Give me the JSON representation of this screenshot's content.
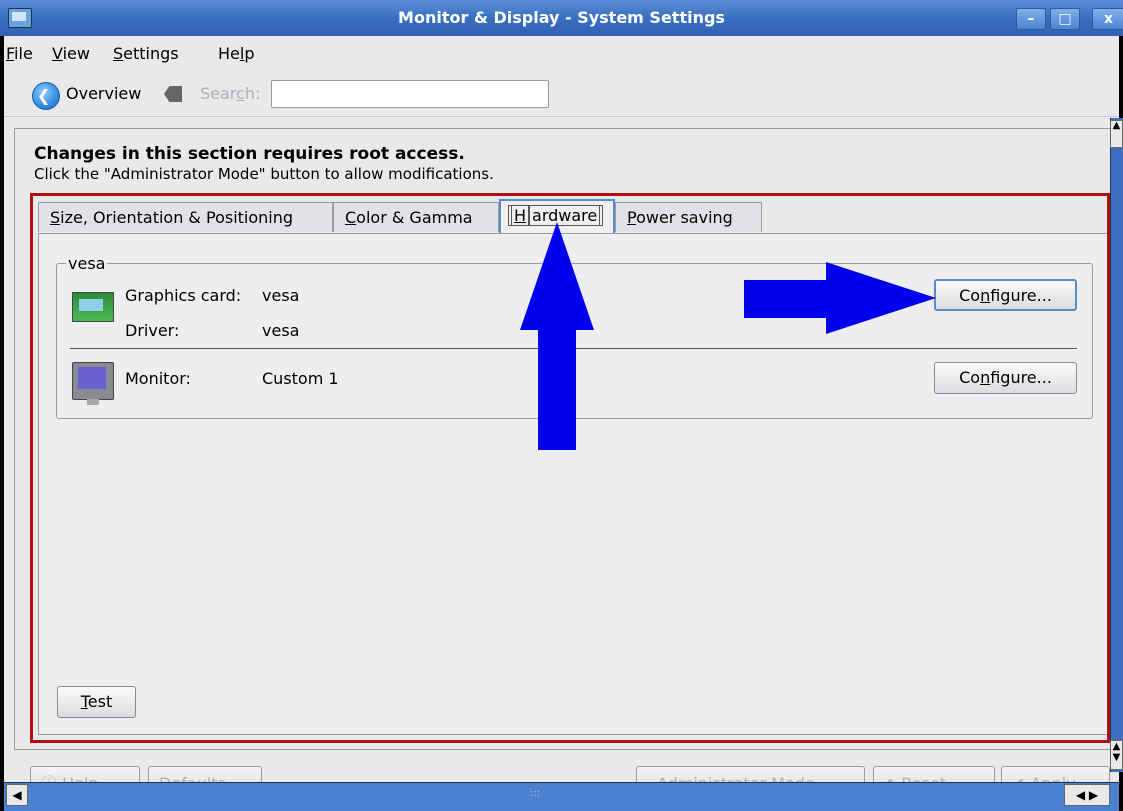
{
  "window": {
    "title": "Monitor & Display - System Settings",
    "controls": {
      "minimize": "–",
      "maximize": "□",
      "close": "x"
    }
  },
  "menubar": [
    {
      "pre": "",
      "key": "F",
      "post": "ile"
    },
    {
      "pre": "",
      "key": "V",
      "post": "iew"
    },
    {
      "pre": "",
      "key": "S",
      "post": "ettings"
    },
    {
      "pre": "He",
      "key": "l",
      "post": "p"
    }
  ],
  "toolbar": {
    "overview_label": "Overview",
    "search_label": {
      "pre": "Sear",
      "key": "c",
      "post": "h:"
    },
    "search_value": ""
  },
  "notice": {
    "title": "Changes in this section requires root access.",
    "subtitle": "Click the \"Administrator Mode\" button to allow modifications."
  },
  "tabs": [
    {
      "pre": "",
      "key": "S",
      "post": "ize, Orientation & Positioning"
    },
    {
      "pre": "",
      "key": "C",
      "post": "olor & Gamma"
    },
    {
      "pre": "",
      "key": "H",
      "post": "ardware"
    },
    {
      "pre": "",
      "key": "P",
      "post": "ower saving"
    }
  ],
  "active_tab": "Hardware",
  "hardware": {
    "group_title": "vesa",
    "graphics_card_label": "Graphics card:",
    "graphics_card_value": "vesa",
    "driver_label": "Driver:",
    "driver_value": "vesa",
    "monitor_label": "Monitor:",
    "monitor_value": "Custom 1",
    "configure": {
      "pre": "Co",
      "key": "n",
      "post": "figure..."
    }
  },
  "test_button": {
    "pre": "",
    "key": "T",
    "post": "est"
  },
  "bottom_buttons": {
    "help": "Help",
    "defaults": "Defaults",
    "admin": "Administrator Mode",
    "reset": "Reset",
    "apply": "Apply"
  },
  "colors": {
    "titlebar": "#3a6fc0",
    "highlight_frame": "#b01010",
    "annotation_arrows": "#0000ee"
  },
  "icons": [
    "app-icon",
    "back-arrow-icon",
    "clear-search-icon",
    "graphics-card-icon",
    "monitor-icon",
    "help-icon",
    "reset-icon",
    "apply-icon"
  ]
}
